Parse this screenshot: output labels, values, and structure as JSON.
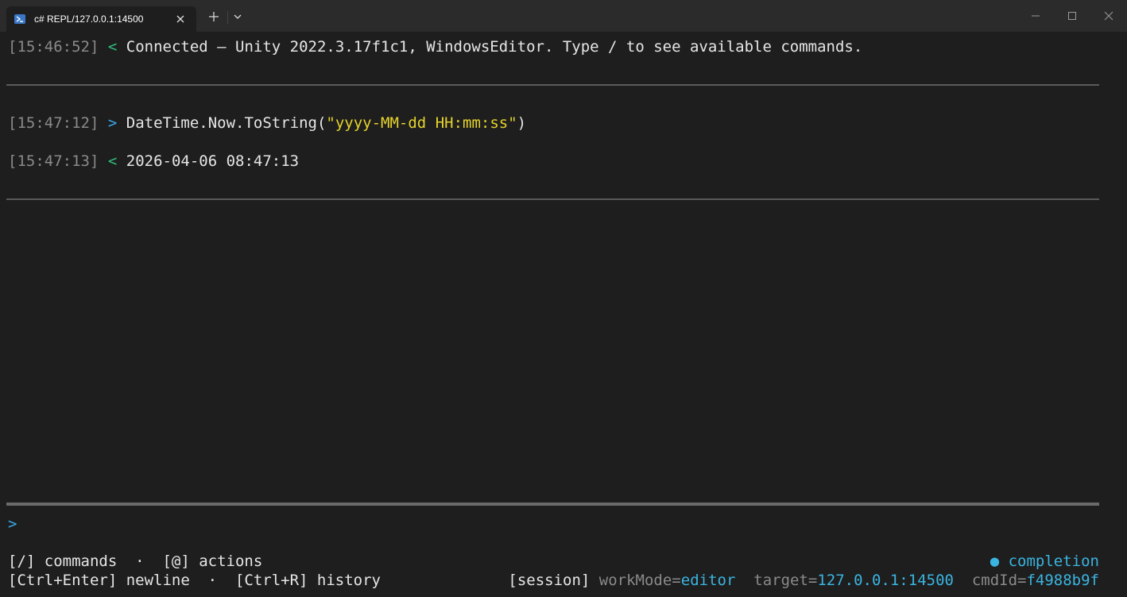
{
  "window": {
    "tab_title": "c# REPL/127.0.0.1:14500"
  },
  "log": [
    {
      "ts": "[15:46:52]",
      "arrow": "<",
      "text": "Connected — Unity 2022.3.17f1c1, WindowsEditor. Type / to see available commands."
    },
    {
      "ts": "[15:47:12]",
      "arrow": ">",
      "code_prefix": "DateTime.Now.ToString(",
      "code_string": "\"yyyy-MM-dd HH:mm:ss\"",
      "code_suffix": ")"
    },
    {
      "ts": "[15:47:13]",
      "arrow": "<",
      "text": "2026-04-06 08:47:13"
    }
  ],
  "input": {
    "prompt": ">"
  },
  "footer": {
    "hint_line1": "[/] commands  ·  [@] actions",
    "hint_line2": "[Ctrl+Enter] newline  ·  [Ctrl+R] history",
    "completion": "● completion",
    "session_label": "[session]",
    "workmode_key": "workMode=",
    "workmode_val": "editor",
    "target_key": "target=",
    "target_val": "127.0.0.1:14500",
    "cmdid_key": "cmdId=",
    "cmdid_val": "f4988b9f"
  },
  "colors": {
    "background": "#1e1e1e",
    "timestamp": "#8a8a8a",
    "response_arrow": "#2fbf7c",
    "input_arrow": "#3aa7e6",
    "string_literal": "#e5d32c",
    "accent_cyan": "#3ab4e0"
  }
}
